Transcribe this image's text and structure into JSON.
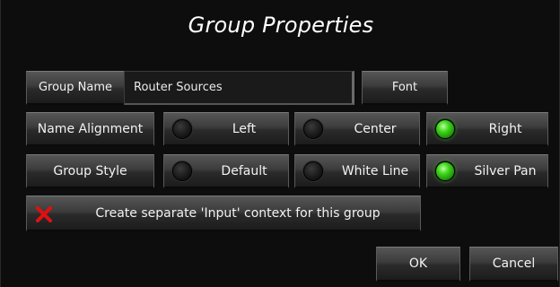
{
  "dialog": {
    "title": "Group Properties"
  },
  "group_name": {
    "label": "Group Name",
    "value": "Router Sources",
    "font_button": "Font"
  },
  "name_alignment": {
    "label": "Name Alignment",
    "options": [
      {
        "label": "Left",
        "selected": false
      },
      {
        "label": "Center",
        "selected": false
      },
      {
        "label": "Right",
        "selected": true
      }
    ]
  },
  "group_style": {
    "label": "Group Style",
    "options": [
      {
        "label": "Default",
        "selected": false
      },
      {
        "label": "White Line",
        "selected": false
      },
      {
        "label": "Silver Pan",
        "selected": true
      }
    ]
  },
  "input_context": {
    "label": "Create separate 'Input' context for this group",
    "checked": false,
    "icon": "red-x-icon"
  },
  "actions": {
    "ok_label": "OK",
    "cancel_label": "Cancel"
  },
  "colors": {
    "led_on": "#3fd41c",
    "led_off": "#1a1a1a",
    "x_mark": "#e01010"
  }
}
